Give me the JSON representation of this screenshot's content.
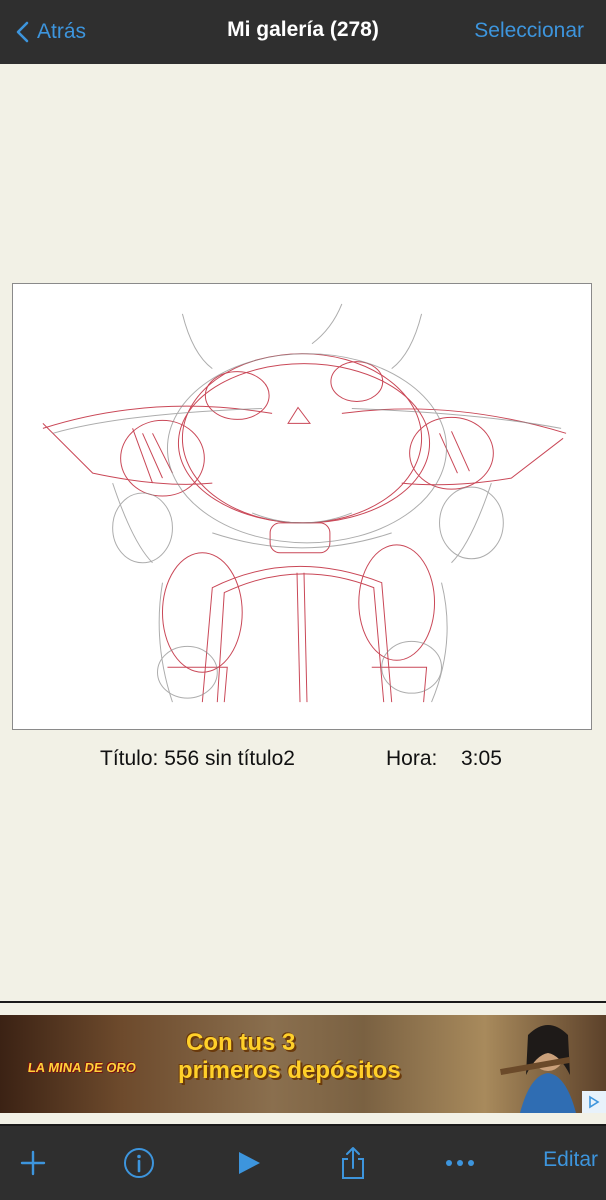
{
  "nav": {
    "back_label": "Atrás",
    "title": "Mi galería (278)",
    "select_label": "Seleccionar"
  },
  "drawing": {
    "title_text": "Título: 556 sin título2",
    "time_label": "Hora:",
    "time_value": "3:05"
  },
  "ad": {
    "logo_text": "LA MINA DE ORO",
    "line1": "Con tus 3",
    "line2": "primeros depósitos"
  },
  "toolbar": {
    "edit_label": "Editar",
    "icons": [
      "plus-icon",
      "info-icon",
      "play-icon",
      "share-icon",
      "more-icon"
    ]
  },
  "colors": {
    "accent": "#3d95dd",
    "bar_bg": "#2f2f2f",
    "page_bg": "#f2f1e6",
    "sketch_red": "#c0283a"
  }
}
